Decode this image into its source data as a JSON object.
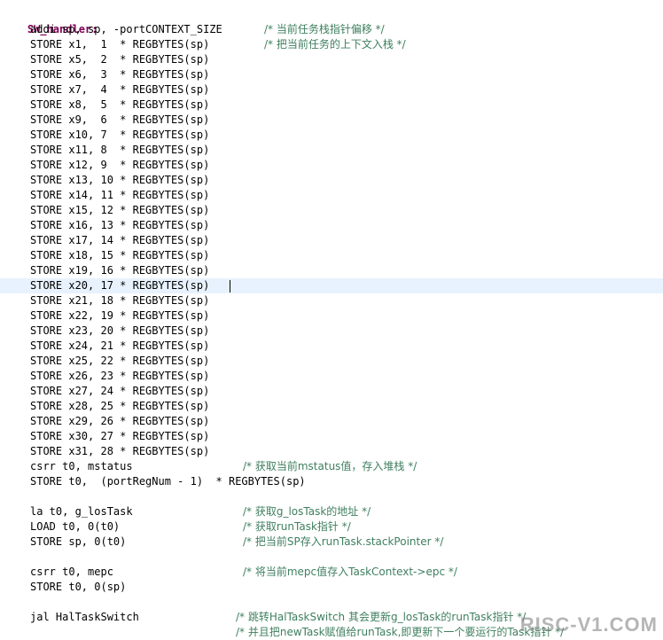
{
  "editor": {
    "label": "SW_handler:",
    "lines": [
      {
        "code": "addi sp, sp, -portCONTEXT_SIZE",
        "comment": "/* 当前任务栈指针偏移 */"
      },
      {
        "code": "STORE x1,  1  * REGBYTES(sp)",
        "comment": "/* 把当前任务的上下文入栈 */"
      },
      {
        "code": "STORE x5,  2  * REGBYTES(sp)",
        "comment": ""
      },
      {
        "code": "STORE x6,  3  * REGBYTES(sp)",
        "comment": ""
      },
      {
        "code": "STORE x7,  4  * REGBYTES(sp)",
        "comment": ""
      },
      {
        "code": "STORE x8,  5  * REGBYTES(sp)",
        "comment": ""
      },
      {
        "code": "STORE x9,  6  * REGBYTES(sp)",
        "comment": ""
      },
      {
        "code": "STORE x10, 7  * REGBYTES(sp)",
        "comment": ""
      },
      {
        "code": "STORE x11, 8  * REGBYTES(sp)",
        "comment": ""
      },
      {
        "code": "STORE x12, 9  * REGBYTES(sp)",
        "comment": ""
      },
      {
        "code": "STORE x13, 10 * REGBYTES(sp)",
        "comment": ""
      },
      {
        "code": "STORE x14, 11 * REGBYTES(sp)",
        "comment": ""
      },
      {
        "code": "STORE x15, 12 * REGBYTES(sp)",
        "comment": ""
      },
      {
        "code": "STORE x16, 13 * REGBYTES(sp)",
        "comment": ""
      },
      {
        "code": "STORE x17, 14 * REGBYTES(sp)",
        "comment": ""
      },
      {
        "code": "STORE x18, 15 * REGBYTES(sp)",
        "comment": ""
      },
      {
        "code": "STORE x19, 16 * REGBYTES(sp)",
        "comment": ""
      },
      {
        "code": "STORE x20, 17 * REGBYTES(sp)",
        "comment": ""
      },
      {
        "code": "STORE x21, 18 * REGBYTES(sp)",
        "comment": ""
      },
      {
        "code": "STORE x22, 19 * REGBYTES(sp)",
        "comment": ""
      },
      {
        "code": "STORE x23, 20 * REGBYTES(sp)",
        "comment": ""
      },
      {
        "code": "STORE x24, 21 * REGBYTES(sp)",
        "comment": ""
      },
      {
        "code": "STORE x25, 22 * REGBYTES(sp)",
        "comment": ""
      },
      {
        "code": "STORE x26, 23 * REGBYTES(sp)",
        "comment": ""
      },
      {
        "code": "STORE x27, 24 * REGBYTES(sp)",
        "comment": ""
      },
      {
        "code": "STORE x28, 25 * REGBYTES(sp)",
        "comment": ""
      },
      {
        "code": "STORE x29, 26 * REGBYTES(sp)",
        "comment": ""
      },
      {
        "code": "STORE x30, 27 * REGBYTES(sp)",
        "comment": ""
      },
      {
        "code": "STORE x31, 28 * REGBYTES(sp)",
        "comment": ""
      },
      {
        "code": "csrr t0, mstatus",
        "comment": "/* 获取当前mstatus值，存入堆栈 */"
      },
      {
        "code": "STORE t0,  (portRegNum - 1)  * REGBYTES(sp)",
        "comment": ""
      },
      {
        "code": "",
        "comment": ""
      },
      {
        "code": "la t0, g_losTask",
        "comment": "/* 获取g_losTask的地址 */"
      },
      {
        "code": "LOAD t0, 0(t0)",
        "comment": "/* 获取runTask指针 */"
      },
      {
        "code": "STORE sp, 0(t0)",
        "comment": "/* 把当前SP存入runTask.stackPointer */"
      },
      {
        "code": "",
        "comment": ""
      },
      {
        "code": "csrr t0, mepc",
        "comment": "/* 将当前mepc值存入TaskContext->epc */"
      },
      {
        "code": "STORE t0, 0(sp)",
        "comment": ""
      },
      {
        "code": "",
        "comment": ""
      },
      {
        "code": "jal HalTaskSwitch",
        "comment": "/* 跳转HalTaskSwitch 其会更新g_losTask的runTask指针 */"
      },
      {
        "code": "",
        "comment": "/* 并且把newTask赋值给runTask,即更新下一个要运行的Task指针 */"
      }
    ],
    "current_line_index": 17,
    "watermark": "RISC-V1.COM"
  }
}
